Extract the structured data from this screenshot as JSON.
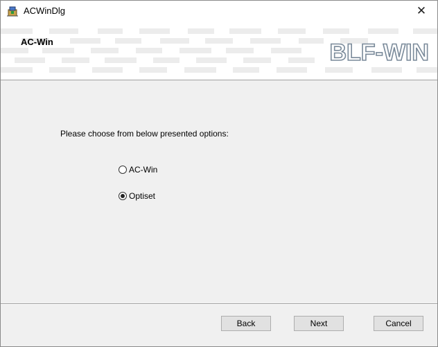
{
  "window": {
    "title": "ACWinDlg",
    "close_glyph": "✕"
  },
  "banner": {
    "title": "AC-Win",
    "logo_text": "BLF-WIN"
  },
  "content": {
    "prompt": "Please choose from below presented options:",
    "options": [
      {
        "label": "AC-Win",
        "checked": false
      },
      {
        "label": "Optiset",
        "checked": true
      }
    ]
  },
  "footer": {
    "back_label": "Back",
    "next_label": "Next",
    "cancel_label": "Cancel"
  },
  "colors": {
    "window_bg": "#f0f0f0",
    "banner_bg": "#ffffff",
    "logo": "#7a8a9a",
    "button_bg": "#e1e1e1",
    "button_border": "#adadad"
  },
  "icons": {
    "app": "installer-icon",
    "close": "close-icon"
  }
}
